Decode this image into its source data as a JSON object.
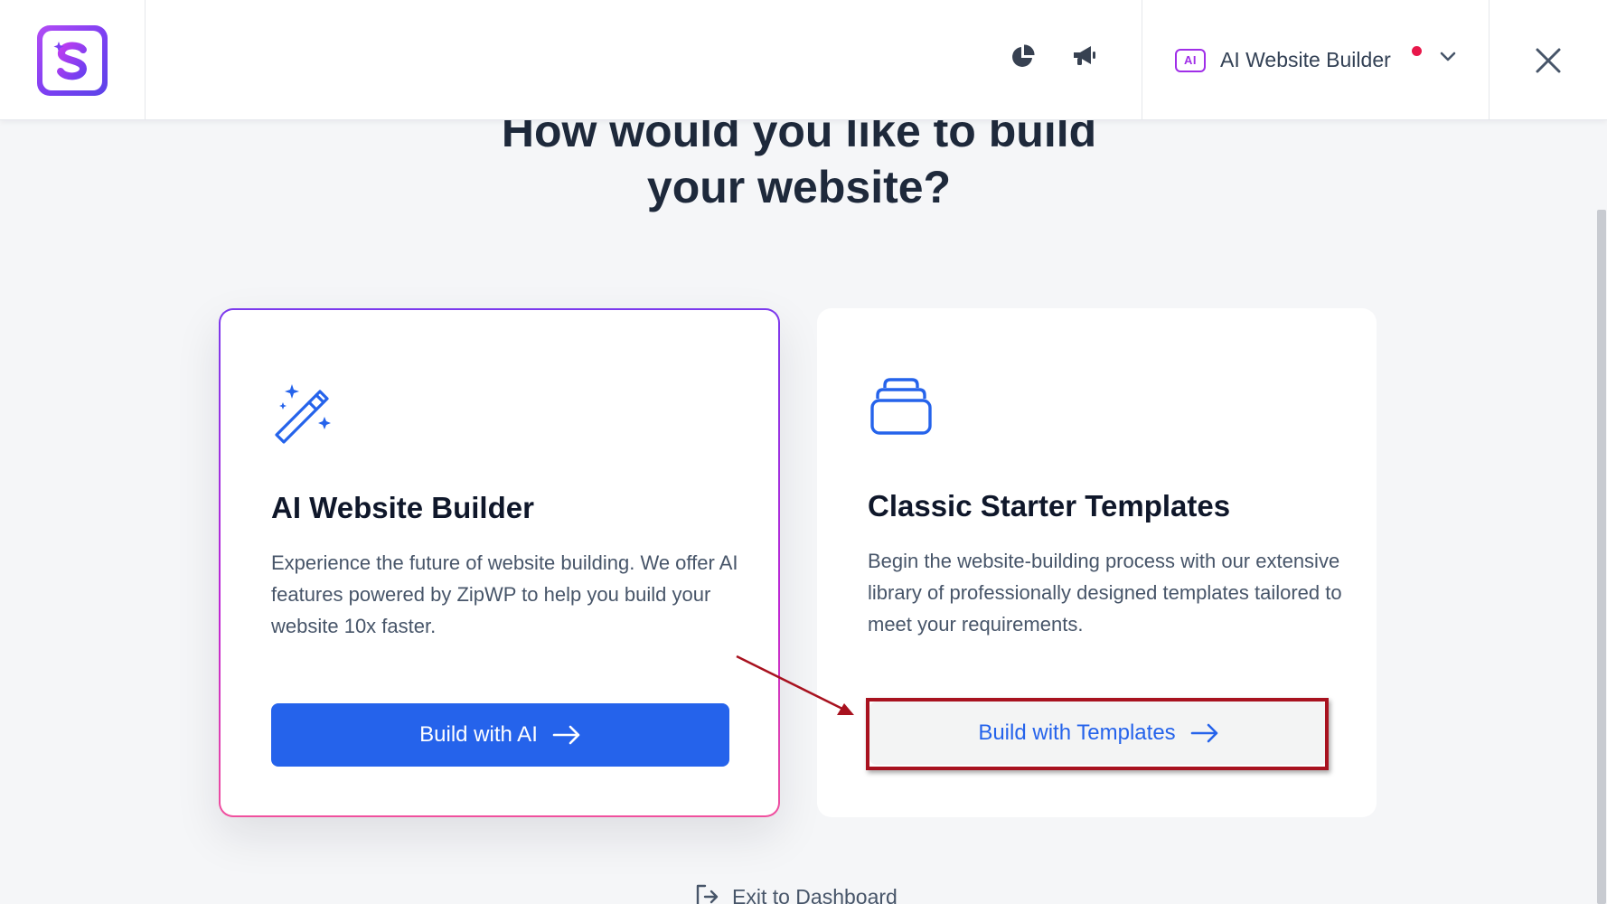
{
  "header": {
    "builder_selector_label": "AI Website Builder",
    "builder_badge": "AI"
  },
  "headline": {
    "line1": "How would you like to build",
    "line2": "your website?"
  },
  "cards": {
    "ai": {
      "title": "AI Website Builder",
      "description": "Experience the future of website building. We offer AI features powered by ZipWP to help you build your website 10x faster.",
      "button_label": "Build with AI",
      "icon": "magic-wand-icon"
    },
    "templates": {
      "title": "Classic Starter Templates",
      "description": "Begin the website-building process with our extensive library of professionally designed templates tailored to meet your requirements.",
      "button_label": "Build with Templates",
      "icon": "stack-icon"
    }
  },
  "footer": {
    "exit_label": "Exit to Dashboard"
  },
  "colors": {
    "primary_blue": "#2563eb",
    "accent_purple": "#a02ee8",
    "annotation_red": "#a8121f",
    "notification_dot": "#e8174a"
  }
}
